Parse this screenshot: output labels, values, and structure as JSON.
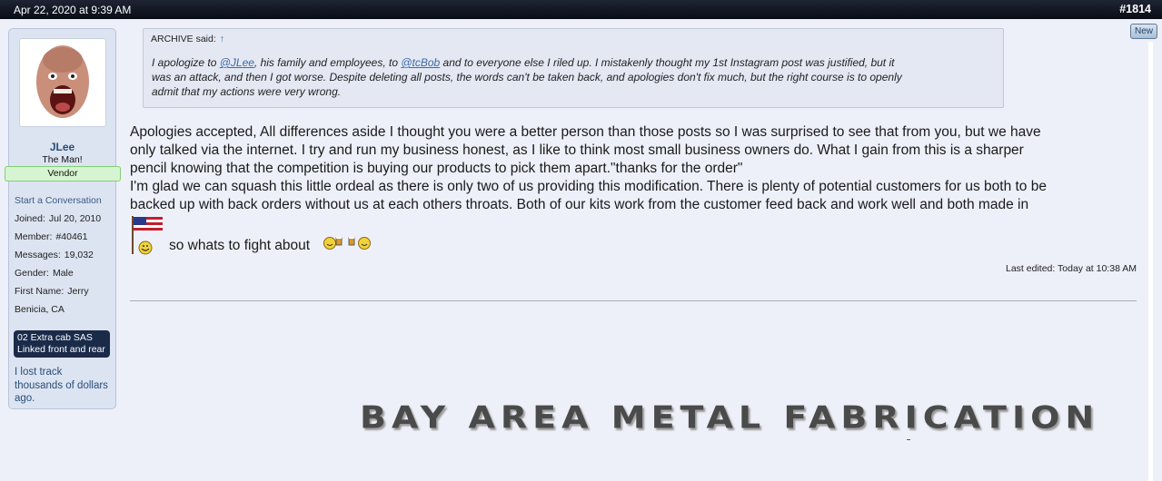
{
  "post": {
    "date": "Apr 22, 2020 at 9:39 AM",
    "number": "#1814",
    "new_label": "New"
  },
  "user": {
    "name": "JLee",
    "title": "The Man!",
    "banner": "Vendor",
    "start_conversation": "Start a Conversation",
    "stats": [
      {
        "label": "Joined:",
        "value": "Jul 20, 2010"
      },
      {
        "label": "Member:",
        "value": "#40461"
      },
      {
        "label": "Messages:",
        "value": "19,032"
      },
      {
        "label": "Gender:",
        "value": "Male"
      },
      {
        "label": "First Name:",
        "value": "Jerry"
      },
      {
        "label": "",
        "value": "Benicia, CA"
      }
    ],
    "custom_field": [
      "02 Extra cab SAS",
      "Linked front and rear"
    ],
    "custom_text": "I lost track thousands of dollars ago."
  },
  "quote": {
    "author": "ARCHIVE said:",
    "arrow": "↑",
    "lines": [
      [
        "I apologize to ",
        "@JLee",
        ", his family and employees, to ",
        "@tcBob",
        " and to everyone else I riled up. I mistakenly thought my 1st Instagram post was justified, but it"
      ],
      [
        "was an attack, and then I got worse. Despite deleting all posts, the words can't be taken back, and apologies don't fix much, but the right course is to openly"
      ],
      [
        "admit that my actions were very wrong."
      ]
    ]
  },
  "message": {
    "lines": [
      "Apologies accepted, All differences aside I thought you were a better person than those posts so I was surprised to see that from you, but we have",
      "only talked via the internet. I try and run my business honest, as I like to think most small business owners do. What I gain from this is a sharper",
      "pencil knowing that the competition is buying our products to pick them apart.\"thanks for the order\"",
      "I'm glad we can squash this little ordeal as there is only two of us providing this modification. There is plenty of potential customers for us both to be",
      "backed up with back orders without us at each others throats. Both of our kits work from the customer feed back and work well and both made in"
    ],
    "closing": "so whats to fight about",
    "last_edited": "Last edited: Today at 10:38 AM"
  },
  "signature": {
    "text": "BAY AREA METAL FABRICATION"
  }
}
